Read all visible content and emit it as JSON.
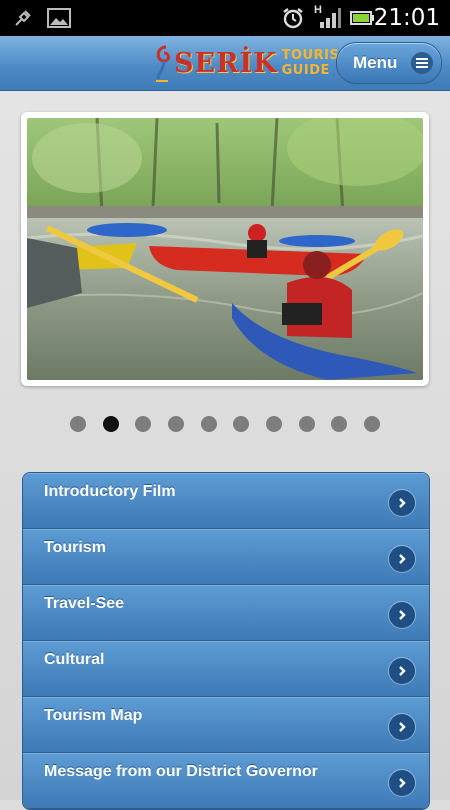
{
  "status_bar": {
    "time": "21:01",
    "network_label": "H",
    "icons": [
      "usb-debug-icon",
      "image-icon",
      "alarm-icon",
      "signal-icon",
      "battery-icon"
    ]
  },
  "header": {
    "logo": {
      "word": "SERİK",
      "line1": "TOURISM",
      "line2": "GUIDE"
    },
    "menu_label": "Menu"
  },
  "slideshow": {
    "current_index": 1,
    "total": 10,
    "image": "kayaking-on-river"
  },
  "menu_items": [
    {
      "label": "Introductory Film"
    },
    {
      "label": "Tourism"
    },
    {
      "label": "Travel-See"
    },
    {
      "label": "Cultural"
    },
    {
      "label": "Tourism Map"
    },
    {
      "label": "Message from our District Governor"
    }
  ],
  "colors": {
    "header_blue": "#4f8cc6",
    "list_blue": "#4a88c2",
    "logo_red": "#c8322a",
    "logo_gold": "#f6b62d"
  }
}
